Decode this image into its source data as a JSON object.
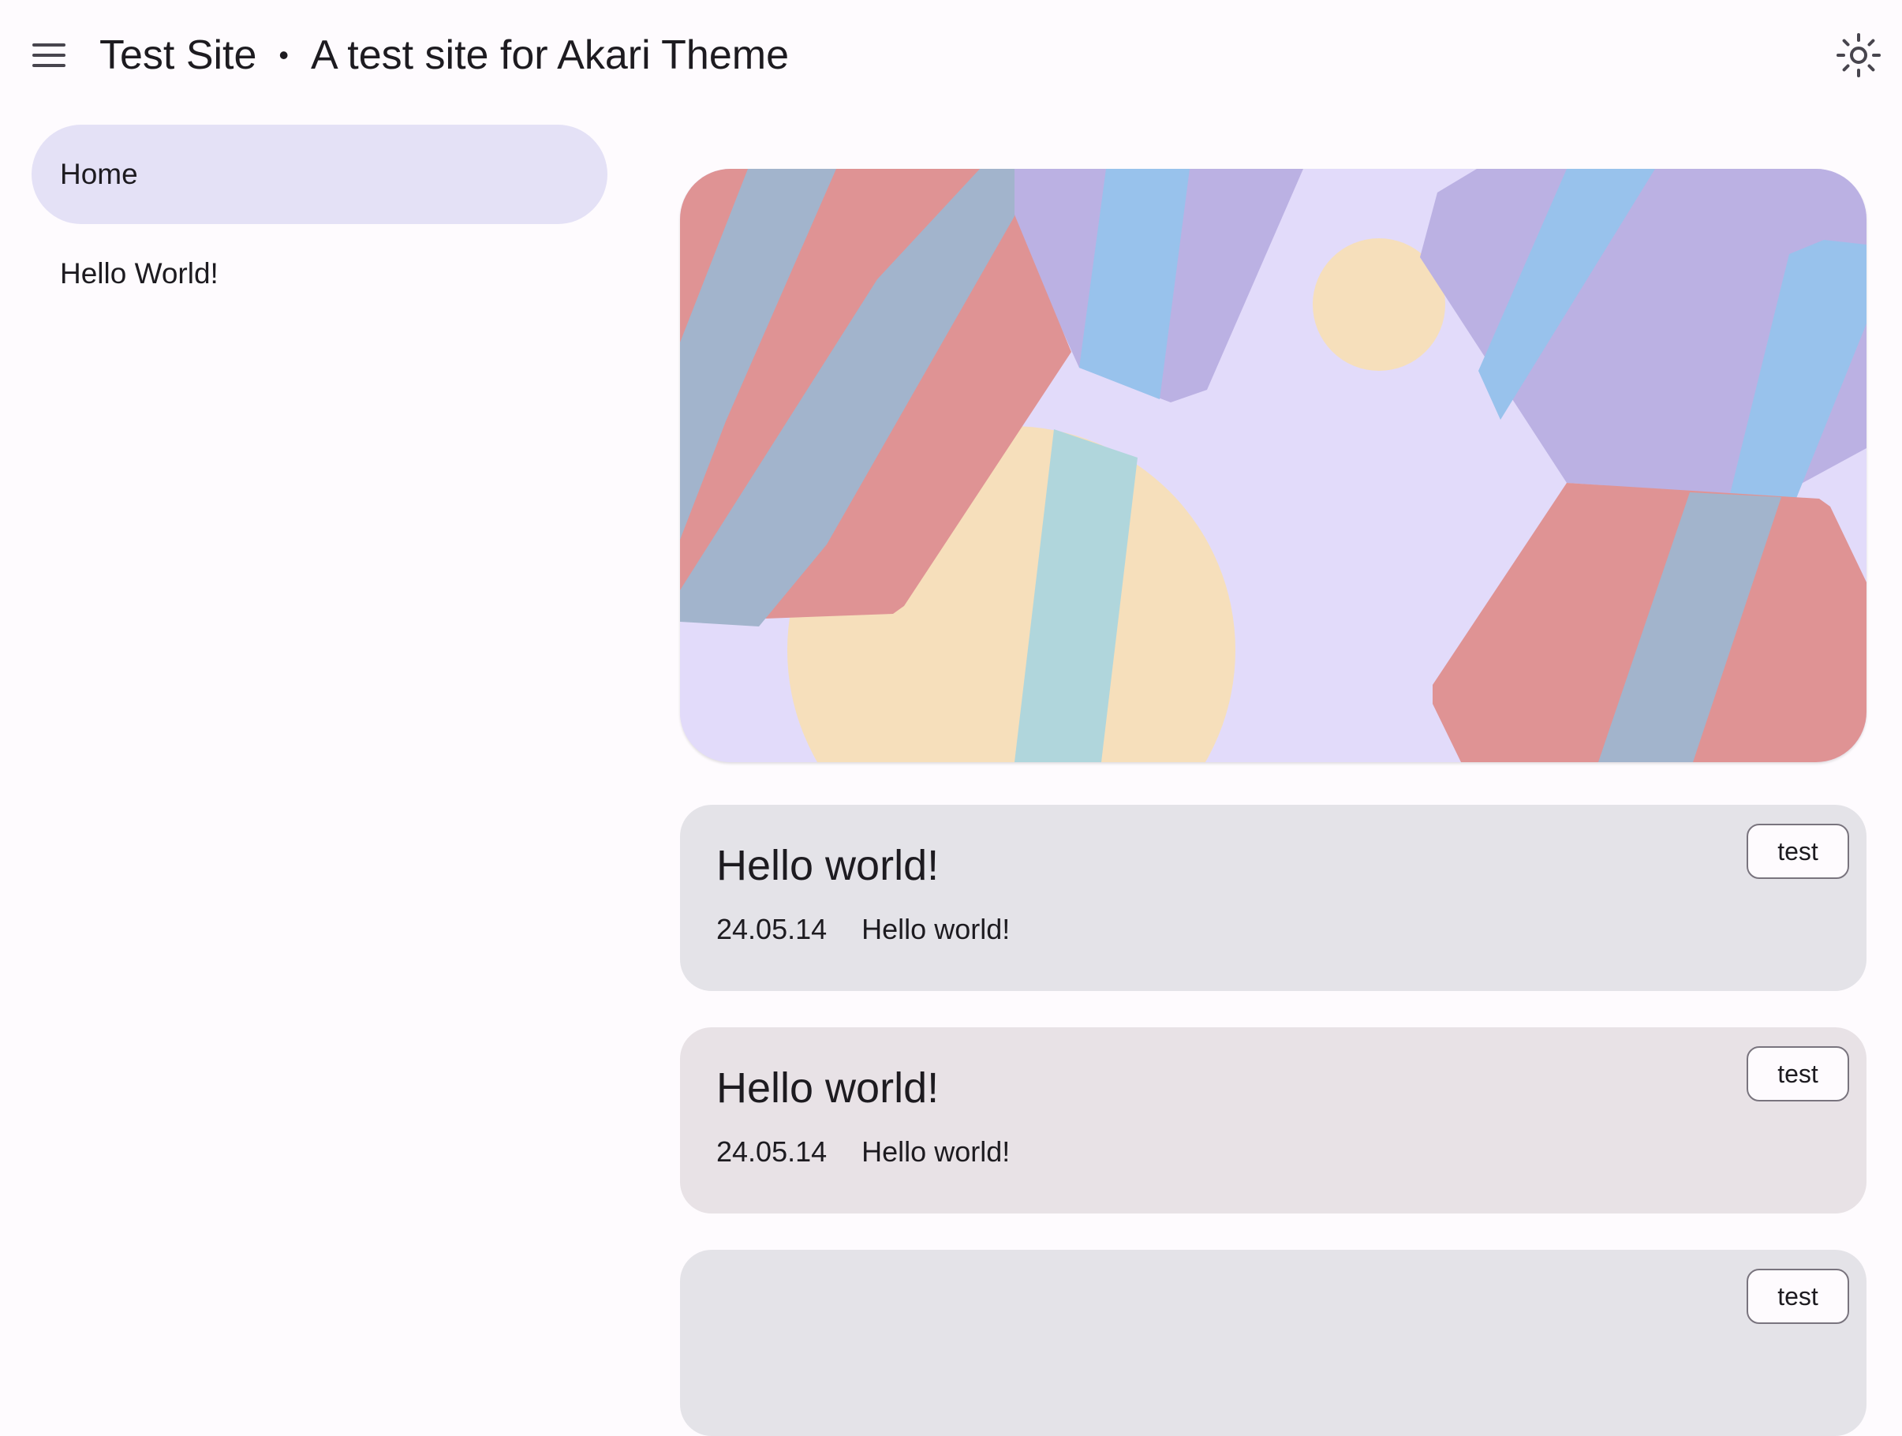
{
  "header": {
    "site_name": "Test Site",
    "separator": "•",
    "tagline": "A test site for Akari Theme",
    "menu_icon": "hamburger-menu-icon",
    "theme_icon": "sun-icon"
  },
  "sidebar": {
    "items": [
      {
        "label": "Home",
        "active": true
      },
      {
        "label": "Hello World!",
        "active": false
      }
    ]
  },
  "posts": [
    {
      "title": "Hello world!",
      "date": "24.05.14",
      "summary": "Hello world!",
      "tag": "test"
    },
    {
      "title": "Hello world!",
      "date": "24.05.14",
      "summary": "Hello world!",
      "tag": "test"
    },
    {
      "title": "",
      "date": "",
      "summary": "",
      "tag": "test"
    }
  ],
  "colors": {
    "background": "#fefbfe",
    "nav_active": "#e4e1f6",
    "card_1": "#e4e3e8",
    "card_2": "#e8e2e6",
    "hero_bg": "#e2dbfa",
    "shape_red": "#df9394",
    "shape_slate": "#a2b4cc",
    "shape_blue": "#98c2ec",
    "shape_purple": "#bbb1e3",
    "shape_sand": "#f6dfbb",
    "shape_teal": "#b0d6dc"
  }
}
